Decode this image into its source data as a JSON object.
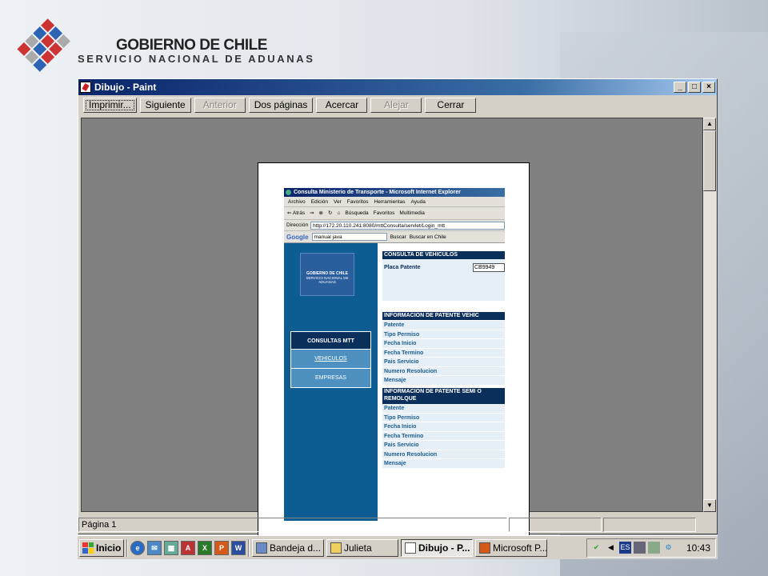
{
  "header": {
    "line1": "GOBIERNO DE CHILE",
    "line2": "SERVICIO NACIONAL DE ADUANAS"
  },
  "window": {
    "title": "Dibujo - Paint",
    "controls": {
      "minimize": "_",
      "maximize": "□",
      "close": "×"
    },
    "toolbar": {
      "print": "Imprimir...",
      "next": "Siguiente",
      "prev": "Anterior",
      "two_pages": "Dos páginas",
      "zoom_in": "Acercar",
      "zoom_out": "Alejar",
      "close": "Cerrar"
    },
    "status": {
      "page": "Página 1"
    }
  },
  "browser": {
    "title": "Consulta Ministerio de Transporte - Microsoft Internet Explorer",
    "menu": [
      "Archivo",
      "Edición",
      "Ver",
      "Favoritos",
      "Herramientas",
      "Ayuda"
    ],
    "nav": {
      "back": "⇐ Atrás",
      "forward": "⇒",
      "search": "Búsqueda",
      "favorites": "Favoritos",
      "multimedia": "Multimedia"
    },
    "address_label": "Dirección",
    "address": "http://172.20.110.241:8080/mttConsulta/servlet/Login_mtt",
    "google": {
      "logo": "Google",
      "query": "manual java",
      "search_btn": "Buscar",
      "search_chile": "Buscar en Chile"
    }
  },
  "site": {
    "brand_line1": "GOBIERNO DE CHILE",
    "brand_line2": "SERVICIO NACIONAL DE ADUANAS",
    "menu_header": "CONSULTAS MTT",
    "menu_items": [
      "VEHICULOS",
      "EMPRESAS"
    ],
    "consulta_title": "CONSULTA DE VEHICULOS",
    "placa_label": "Placa Patente",
    "placa_value": "CB9949",
    "info_title": "INFORMACION DE PATENTE VEHIC",
    "info_fields": [
      "Patente",
      "Tipo Permiso",
      "Fecha Inicio",
      "Fecha Termino",
      "Pais Servicio",
      "Numero Resolucion",
      "Mensaje"
    ],
    "semi_title": "INFORMACION DE PATENTE SEMI O REMOLQUE",
    "semi_fields": [
      "Patente",
      "Tipo Permiso",
      "Fecha Inicio",
      "Fecha Termino",
      "Pais Servicio",
      "Numero Resolucion",
      "Mensaje"
    ]
  },
  "taskbar": {
    "start": "Inicio",
    "tasks": [
      "Bandeja d...",
      "Julieta",
      "Dibujo - P...",
      "Microsoft P..."
    ],
    "lang": "ES",
    "clock": "10:43"
  }
}
